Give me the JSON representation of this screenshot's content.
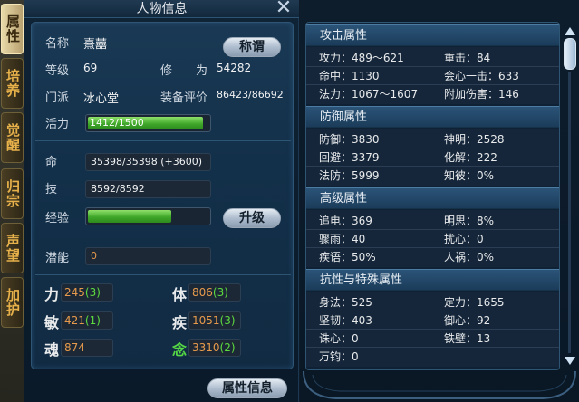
{
  "window": {
    "title": "人物信息"
  },
  "side_tabs": [
    "属性",
    "培养",
    "觉醒",
    "归宗",
    "声望",
    "加护"
  ],
  "profile": {
    "name_label": "名称",
    "name_value": "熹囍",
    "title_button": "称谓",
    "level_label": "等级",
    "level_value": "69",
    "cultivation_label": "修　　为",
    "cultivation_value": "54282",
    "sect_label": "门派",
    "sect_value": "冰心堂",
    "gear_label": "装备评价",
    "gear_value": "86423/86692",
    "vitality_label": "活力",
    "vitality_value": "1412/1500",
    "vitality_fraction": 0.941
  },
  "status": {
    "hp_label": "命",
    "hp_value": "35398/35398 (+3600)",
    "skill_label": "技",
    "skill_value": "8592/8592",
    "exp_label": "经验",
    "exp_fraction": 0.68,
    "upgrade_button": "升级",
    "potential_label": "潜能",
    "potential_value": "0"
  },
  "attributes": [
    {
      "label": "力",
      "base": "245",
      "bonus": "(3)",
      "green": false
    },
    {
      "label": "体",
      "base": "806",
      "bonus": "(3)",
      "green": false
    },
    {
      "label": "敏",
      "base": "421",
      "bonus": "(1)",
      "green": false
    },
    {
      "label": "疾",
      "base": "1051",
      "bonus": "(3)",
      "green": false
    },
    {
      "label": "魂",
      "base": "874",
      "bonus": "",
      "green": false
    },
    {
      "label": "念",
      "base": "3310",
      "bonus": "(2)",
      "green": true
    }
  ],
  "footer": {
    "attr_info_button": "属性信息"
  },
  "attr_sections": [
    {
      "title": "攻击属性",
      "rows": [
        {
          "left": "攻力：489～621",
          "right": "重击：84"
        },
        {
          "left": "命中：1130",
          "right": "会心一击：633"
        },
        {
          "left": "法力：1067～1607",
          "right": "附加伤害：146"
        }
      ]
    },
    {
      "title": "防御属性",
      "rows": [
        {
          "left": "防御：3830",
          "right": "神明：2528"
        },
        {
          "left": "回避：3379",
          "right": "化解：222"
        },
        {
          "left": "法防：5999",
          "right": "知彼：0%"
        }
      ]
    },
    {
      "title": "高级属性",
      "rows": [
        {
          "left": "追电：369",
          "right": "明思：8%"
        },
        {
          "left": "骤雨：40",
          "right": "扰心：0"
        },
        {
          "left": "疾语：50%",
          "right": "人祸：0%"
        }
      ]
    },
    {
      "title": "抗性与特殊属性",
      "rows": [
        {
          "left": "身法：525",
          "right": "定力：1655"
        },
        {
          "left": "坚韧：403",
          "right": "御心：92"
        },
        {
          "left": "诛心：0",
          "right": "铁壁：13"
        },
        {
          "left": "万钧：0",
          "right": ""
        }
      ]
    }
  ],
  "icons": {
    "close": "close-icon",
    "scroll_up": "scroll-up-arrow-icon",
    "scroll_down": "scroll-down-arrow-icon"
  },
  "colors": {
    "accent_orange": "#e79a4b",
    "bonus_green": "#5ddc3f",
    "bar_green": "#3fa82a",
    "tab_gold": "#e6b14a"
  }
}
